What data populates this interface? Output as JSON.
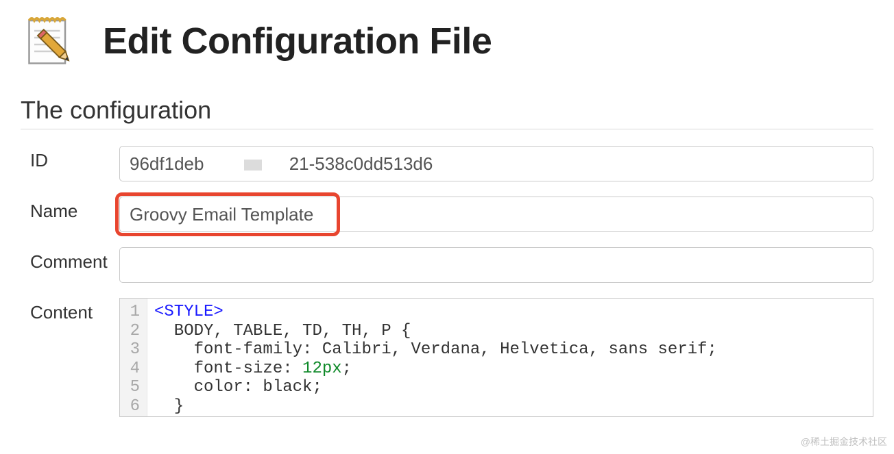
{
  "header": {
    "title": "Edit Configuration File"
  },
  "section": {
    "title": "The configuration"
  },
  "form": {
    "id": {
      "label": "ID",
      "value": "96df1deb            -8621-538c0dd513d6"
    },
    "name": {
      "label": "Name",
      "value": "Groovy Email Template"
    },
    "comment": {
      "label": "Comment",
      "value": ""
    },
    "content": {
      "label": "Content",
      "lines": [
        "<STYLE>",
        "  BODY, TABLE, TD, TH, P {",
        "    font-family: Calibri, Verdana, Helvetica, sans serif;",
        "    font-size: 12px;",
        "    color: black;",
        "  }"
      ],
      "line_numbers": [
        "1",
        "2",
        "3",
        "4",
        "5",
        "6"
      ]
    }
  },
  "watermark": "@稀土掘金技术社区"
}
